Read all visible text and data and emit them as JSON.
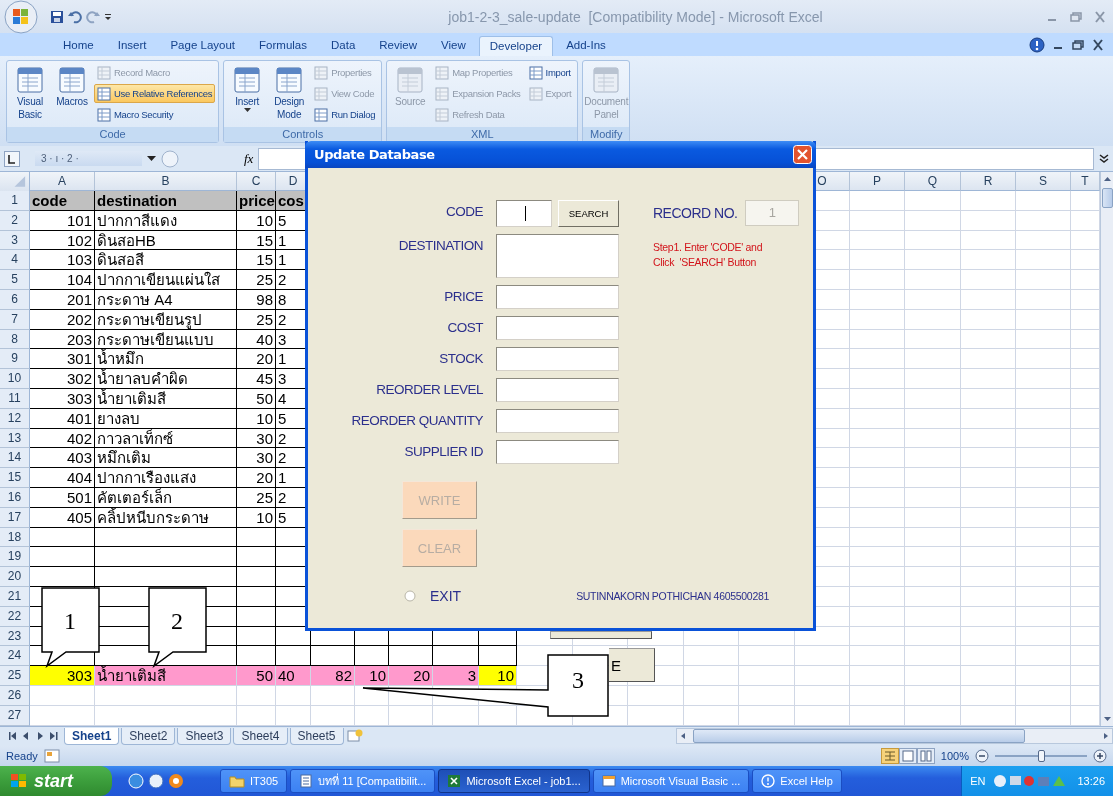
{
  "window": {
    "title": "job1-2-3_sale-update  [Compatibility Mode] - Microsoft Excel"
  },
  "ribbon_tabs": [
    {
      "label": "Home",
      "selected": false
    },
    {
      "label": "Insert",
      "selected": false
    },
    {
      "label": "Page Layout",
      "selected": false
    },
    {
      "label": "Formulas",
      "selected": false
    },
    {
      "label": "Data",
      "selected": false
    },
    {
      "label": "Review",
      "selected": false
    },
    {
      "label": "View",
      "selected": false
    },
    {
      "label": "Developer",
      "selected": true
    },
    {
      "label": "Add-Ins",
      "selected": false
    }
  ],
  "ribbon_groups": [
    {
      "label": "Code",
      "commands": [
        {
          "label": "Visual Basic",
          "kind": "large",
          "disabled": false,
          "on": false
        },
        {
          "label": "Macros",
          "kind": "large",
          "disabled": false,
          "on": false
        },
        {
          "label": "Record Macro",
          "kind": "small",
          "disabled": true,
          "on": false
        },
        {
          "label": "Use Relative References",
          "kind": "small",
          "disabled": false,
          "on": true
        },
        {
          "label": "Macro Security",
          "kind": "small",
          "disabled": false,
          "on": false
        }
      ]
    },
    {
      "label": "Controls",
      "commands": [
        {
          "label": "Insert",
          "kind": "menu",
          "disabled": false,
          "on": false
        },
        {
          "label": "Design Mode",
          "kind": "large",
          "disabled": false,
          "on": false
        },
        {
          "label": "Properties",
          "kind": "small",
          "disabled": true,
          "on": false
        },
        {
          "label": "View Code",
          "kind": "small",
          "disabled": true,
          "on": false
        },
        {
          "label": "Run Dialog",
          "kind": "small",
          "disabled": false,
          "on": false
        }
      ]
    },
    {
      "label": "XML",
      "commands": [
        {
          "label": "Source",
          "kind": "large",
          "disabled": true,
          "on": false
        },
        {
          "label": "Map Properties",
          "kind": "small",
          "disabled": true,
          "on": false
        },
        {
          "label": "Expansion Packs",
          "kind": "small",
          "disabled": true,
          "on": false
        },
        {
          "label": "Refresh Data",
          "kind": "small",
          "disabled": true,
          "on": false
        },
        {
          "label": "Import",
          "kind": "small",
          "disabled": false,
          "on": false
        },
        {
          "label": "Export",
          "kind": "small",
          "disabled": true,
          "on": false
        }
      ]
    },
    {
      "label": "Modify",
      "commands": [
        {
          "label": "Document Panel",
          "kind": "large",
          "disabled": true,
          "on": false
        }
      ]
    }
  ],
  "formula_bar": {
    "name_box": "3 · ı · 2 ·",
    "function_label": "fx"
  },
  "columns_left": [
    "A",
    "B",
    "C",
    "D"
  ],
  "columns_right": [
    "O",
    "P",
    "Q",
    "R",
    "S",
    "T"
  ],
  "rows": [
    {
      "num": "1",
      "kind": "header",
      "cells": [
        {
          "text": "code"
        },
        {
          "text": "destination"
        },
        {
          "text": "price"
        },
        {
          "text": "cos"
        }
      ]
    },
    {
      "num": "2",
      "kind": "data",
      "cells": [
        {
          "text": "101"
        },
        {
          "text": "ปากกาสีแดง"
        },
        {
          "text": "10"
        },
        {
          "text": "5"
        }
      ]
    },
    {
      "num": "3",
      "kind": "data",
      "cells": [
        {
          "text": "102"
        },
        {
          "text": "ดินสอHB"
        },
        {
          "text": "15"
        },
        {
          "text": "1"
        }
      ]
    },
    {
      "num": "4",
      "kind": "data",
      "cells": [
        {
          "text": "103"
        },
        {
          "text": "ดินสอสี"
        },
        {
          "text": "15"
        },
        {
          "text": "1"
        }
      ]
    },
    {
      "num": "5",
      "kind": "data",
      "cells": [
        {
          "text": "104"
        },
        {
          "text": "ปากกาเขียนแผ่นใส"
        },
        {
          "text": "25"
        },
        {
          "text": "2"
        }
      ]
    },
    {
      "num": "6",
      "kind": "data",
      "cells": [
        {
          "text": "201"
        },
        {
          "text": "กระดาษ A4"
        },
        {
          "text": "98"
        },
        {
          "text": "8"
        }
      ]
    },
    {
      "num": "7",
      "kind": "data",
      "cells": [
        {
          "text": "202"
        },
        {
          "text": "กระดาษเขียนรูป"
        },
        {
          "text": "25"
        },
        {
          "text": "2"
        }
      ]
    },
    {
      "num": "8",
      "kind": "data",
      "cells": [
        {
          "text": "203"
        },
        {
          "text": "กระดาษเขียนแบบ"
        },
        {
          "text": "40"
        },
        {
          "text": "3"
        }
      ]
    },
    {
      "num": "9",
      "kind": "data",
      "cells": [
        {
          "text": "301"
        },
        {
          "text": "น้ำหมึก"
        },
        {
          "text": "20"
        },
        {
          "text": "1"
        }
      ]
    },
    {
      "num": "10",
      "kind": "data",
      "cells": [
        {
          "text": "302"
        },
        {
          "text": "น้ำยาลบคำผิด"
        },
        {
          "text": "45"
        },
        {
          "text": "3"
        }
      ]
    },
    {
      "num": "11",
      "kind": "data",
      "cells": [
        {
          "text": "303"
        },
        {
          "text": "น้ำยาเติมสี"
        },
        {
          "text": "50"
        },
        {
          "text": "4"
        }
      ]
    },
    {
      "num": "12",
      "kind": "data",
      "cells": [
        {
          "text": "401"
        },
        {
          "text": "ยางลบ"
        },
        {
          "text": "10"
        },
        {
          "text": "5"
        }
      ]
    },
    {
      "num": "13",
      "kind": "data",
      "cells": [
        {
          "text": "402"
        },
        {
          "text": "กาวลาเท็กซ์"
        },
        {
          "text": "30"
        },
        {
          "text": "2"
        }
      ]
    },
    {
      "num": "14",
      "kind": "data",
      "cells": [
        {
          "text": "403"
        },
        {
          "text": "หมึกเติม"
        },
        {
          "text": "30"
        },
        {
          "text": "2"
        }
      ]
    },
    {
      "num": "15",
      "kind": "data",
      "cells": [
        {
          "text": "404"
        },
        {
          "text": "ปากกาเรืองแสง"
        },
        {
          "text": "20"
        },
        {
          "text": "1"
        }
      ]
    },
    {
      "num": "16",
      "kind": "data",
      "cells": [
        {
          "text": "501"
        },
        {
          "text": "คัตเตอร์เล็ก"
        },
        {
          "text": "25"
        },
        {
          "text": "2"
        }
      ]
    },
    {
      "num": "17",
      "kind": "data",
      "cells": [
        {
          "text": "405"
        },
        {
          "text": "คลิ้ปหนีบกระดาษ"
        },
        {
          "text": "10"
        },
        {
          "text": "5"
        }
      ]
    },
    {
      "num": "18",
      "kind": "grid"
    },
    {
      "num": "19",
      "kind": "grid"
    },
    {
      "num": "20",
      "kind": "grid"
    },
    {
      "num": "21",
      "kind": "grid"
    },
    {
      "num": "22",
      "kind": "grid"
    },
    {
      "num": "23",
      "kind": "grid"
    },
    {
      "num": "24",
      "kind": "grid"
    },
    {
      "num": "25",
      "kind": "plain",
      "cells": [
        {
          "text": "303",
          "color": "#ffff00"
        },
        {
          "text": "น้ำยาเติมสี",
          "color": "#ff99cc"
        },
        {
          "text": "50",
          "color": "#ff99cc"
        },
        {
          "text": "40",
          "color": "#ff99cc"
        },
        {
          "text": "82",
          "color": "#ff99cc"
        },
        {
          "text": "10",
          "color": "#ff99cc"
        },
        {
          "text": "20",
          "color": "#ff99cc"
        },
        {
          "text": "3",
          "color": "#ff99cc"
        },
        {
          "text": "10",
          "color": "#ffff00"
        }
      ]
    },
    {
      "num": "26",
      "kind": "plain"
    },
    {
      "num": "27",
      "kind": "plain"
    }
  ],
  "sheet_button_label": "E",
  "callouts": [
    {
      "label": "1"
    },
    {
      "label": "2"
    },
    {
      "label": "3"
    }
  ],
  "dialog": {
    "title": "Update Database",
    "fields": [
      {
        "label": "CODE",
        "kind": "search",
        "focused": true
      },
      {
        "label": "DESTINATION",
        "kind": "tall",
        "focused": false
      },
      {
        "label": "PRICE",
        "kind": "plain",
        "focused": false
      },
      {
        "label": "COST",
        "kind": "plain",
        "focused": false
      },
      {
        "label": "STOCK",
        "kind": "plain",
        "focused": false
      },
      {
        "label": "REORDER LEVEL",
        "kind": "plain",
        "focused": false
      },
      {
        "label": "REORDER QUANTITY",
        "kind": "plain",
        "focused": false
      },
      {
        "label": "SUPPLIER ID",
        "kind": "plain",
        "focused": false
      }
    ],
    "search_button": "SEARCH",
    "record": {
      "label": "RECORD NO.",
      "value": "1",
      "disabled": true
    },
    "hint": "Step1. Enter 'CODE' and\nClick  'SEARCH' Button",
    "buttons": [
      {
        "label": "WRITE",
        "disabled": true
      },
      {
        "label": "CLEAR",
        "disabled": true
      }
    ],
    "exit": {
      "label": "EXIT",
      "selected": false
    },
    "author": "SUTINNAKORN POTHICHAN 4605500281"
  },
  "sheet_tabs": [
    {
      "label": "Sheet1",
      "selected": true
    },
    {
      "label": "Sheet2",
      "selected": false
    },
    {
      "label": "Sheet3",
      "selected": false
    },
    {
      "label": "Sheet4",
      "selected": false
    },
    {
      "label": "Sheet5",
      "selected": false
    }
  ],
  "status_bar": {
    "status": "Ready",
    "zoom": "100%",
    "zoom_slider": {
      "level": 0.5
    }
  },
  "taskbar": {
    "start": "start",
    "tasks": [
      {
        "label": "IT305",
        "selected": false
      },
      {
        "label": "บทที่ 11 [Compatibilit...",
        "selected": false
      },
      {
        "label": "Microsoft Excel - job1...",
        "selected": true
      },
      {
        "label": "Microsoft Visual Basic ...",
        "selected": false
      },
      {
        "label": "Excel Help",
        "selected": false
      }
    ],
    "language": "EN",
    "clock": "13:26"
  }
}
